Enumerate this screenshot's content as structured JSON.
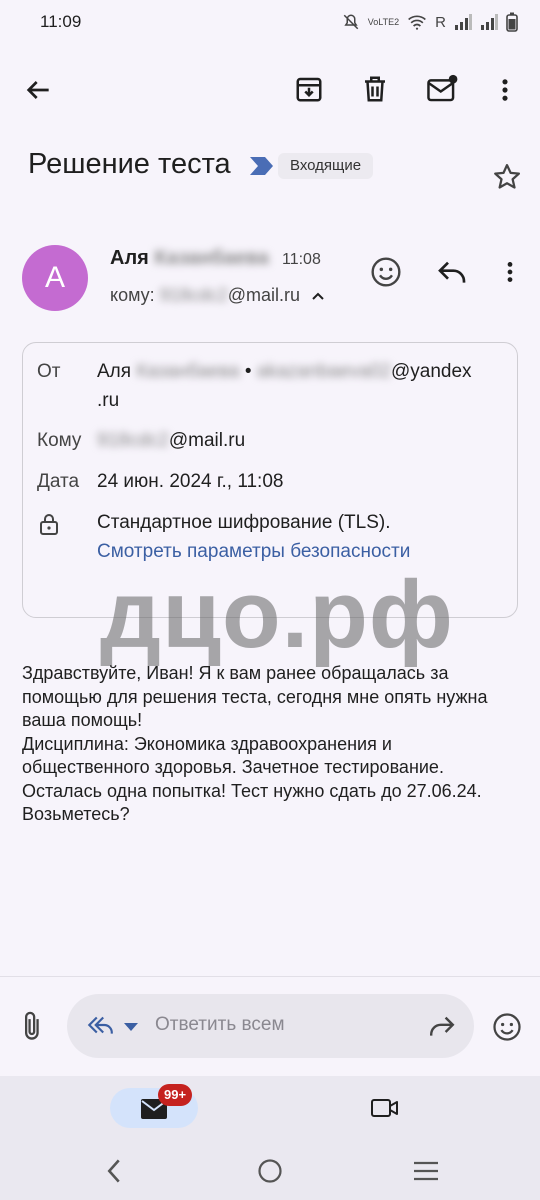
{
  "status_bar": {
    "time": "11:09",
    "network_label": "R",
    "volte_label": "VoLTE2"
  },
  "subject": {
    "title": "Решение теста",
    "label": "Входящие"
  },
  "sender": {
    "avatar_letter": "A",
    "name": "Аля",
    "surname_blurred": "Казанбаева",
    "time": "11:08",
    "to_prefix": "кому:",
    "to_blurred": "918cdc2",
    "to_domain": "@mail.ru"
  },
  "details": {
    "from_label": "От",
    "from_name": "Аля",
    "from_name_blurred": "Казанбаева",
    "from_sep": "•",
    "from_email_blurred": "akazanbaeva02",
    "from_domain_line1": "@yandex",
    "from_domain_line2": ".ru",
    "to_label": "Кому",
    "to_blurred": "918cdc2",
    "to_domain": "@mail.ru",
    "date_label": "Дата",
    "date_value": "24 июн. 2024 г., 11:08",
    "encryption": "Стандартное шифрование (TLS).",
    "security_link": "Смотреть параметры безопасности"
  },
  "watermark": "дцо.рф",
  "body": "Здравствуйте, Иван!  Я к вам ранее обращалась за помощью для решения теста, сегодня мне опять нужна ваша помощь!\nДисциплина: Экономика здравоохранения и общественного здоровья. Зачетное тестирование. Осталась одна попытка! Тест нужно сдать до 27.06.24. Возьметесь?",
  "reply": {
    "placeholder": "Ответить всем"
  },
  "bottom_nav": {
    "badge": "99+"
  },
  "colors": {
    "avatar": "#c46bd1",
    "link": "#3b5fa3",
    "badge": "#c5221f",
    "pill": "#d4e3fb"
  }
}
